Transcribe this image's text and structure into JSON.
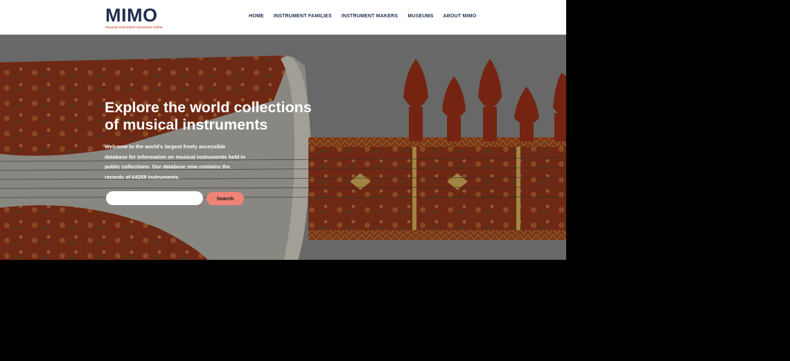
{
  "logo": {
    "name": "MIMO",
    "tagline": "musical instrument museums online"
  },
  "nav": {
    "items": [
      {
        "label": "HOME"
      },
      {
        "label": "INSTRUMENT FAMILIES"
      },
      {
        "label": "INSTRUMENT MAKERS"
      },
      {
        "label": "MUSEUMS"
      },
      {
        "label": "ABOUT MIMO"
      }
    ]
  },
  "hero": {
    "title_line1": "Explore the world collections",
    "title_line2": "of musical instruments",
    "description": "Welcome to the world's largest freely accessible database for information on musical instruments held in public collections. Our database now contains the records of 64259 instruments.",
    "image_icon": "stringed-instrument-photo"
  },
  "search": {
    "placeholder": "",
    "value": "",
    "button_label": "Search"
  },
  "colors": {
    "brand": "#1e2d4f",
    "accent": "#f08378",
    "tagline": "#c4381d"
  }
}
